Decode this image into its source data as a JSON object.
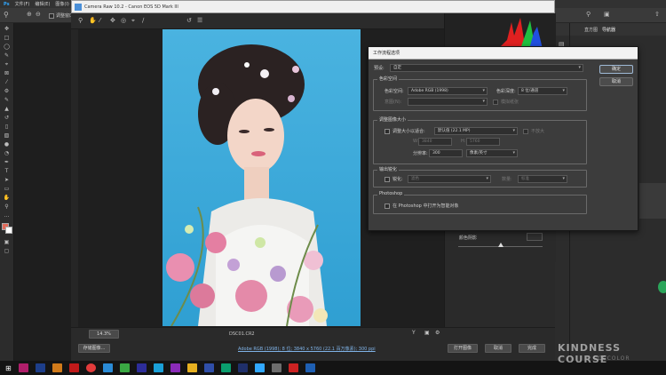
{
  "photoshop": {
    "menu": [
      "文件(F)",
      "编辑(E)",
      "图像(I)"
    ],
    "options_bar": {
      "search_label": "调整窗口大"
    },
    "right_panel_tabs": [
      "直方图",
      "导航器"
    ]
  },
  "camera_raw": {
    "title": "Camera Raw 10.2  -  Canon EOS 5D Mark III",
    "filename": "DSC01.CR2",
    "zoom": "14.3%",
    "workflow_link": "Adobe RGB (1998); 8 位; 3840 x 5760 (22.1 百万像素); 300 ppi",
    "save_image_button": "存储图像...",
    "open_image_button": "打开图像",
    "cancel_button": "取消",
    "done_button": "完成",
    "slider_label": "颜色阴影"
  },
  "workflow_dialog": {
    "title": "工作流程选项",
    "preset_label": "预设:",
    "preset_value": "自定",
    "ok_button": "确定",
    "cancel_button": "取消",
    "color_space": {
      "heading": "色彩空间",
      "space_label": "色彩空间:",
      "space_value": "Adobe RGB (1998)",
      "depth_label": "色彩深度:",
      "depth_value": "8 位/通道",
      "intent_label": "意图(N):",
      "simulate_label": "模拟纸张"
    },
    "resize": {
      "heading": "调整图像大小",
      "checkbox_label": "调整大小以适合:",
      "fit_value": "默认值 (22.1 MP)",
      "enlarge_label": "不放大",
      "w_label": "W:",
      "w_value": "3840",
      "h_label": "H:",
      "h_value": "5760",
      "resolution_label": "分辨率:",
      "resolution_value": "300",
      "resolution_unit": "像素/英寸"
    },
    "sharpen": {
      "heading": "输出锐化",
      "checkbox_label": "锐化:",
      "target_value": "滤色",
      "amount_label": "数量:",
      "amount_value": "标准"
    },
    "photoshop": {
      "heading": "Photoshop",
      "checkbox_label": "在 Photoshop 中打开为智能对象"
    }
  },
  "watermark": {
    "main": "KINDNESS COURSE",
    "sub": "CCCCOLOR"
  },
  "colors": {
    "photo_bg": "#3aa7d8",
    "dialog_bg": "#3c3c3c",
    "titlebar": "#f0f0f0"
  }
}
